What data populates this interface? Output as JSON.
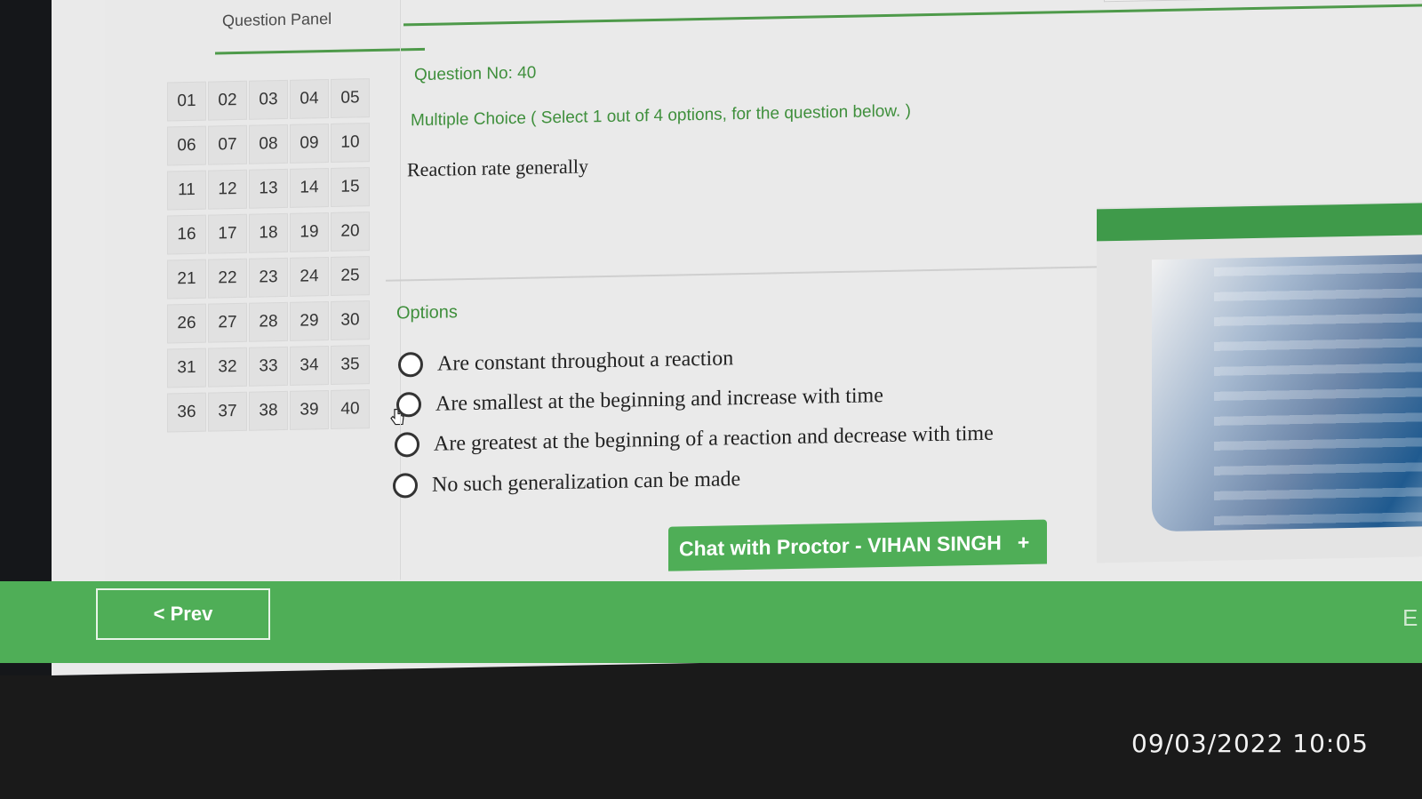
{
  "panel": {
    "title": "Question Panel",
    "questions": [
      "01",
      "02",
      "03",
      "04",
      "05",
      "06",
      "07",
      "08",
      "09",
      "10",
      "11",
      "12",
      "13",
      "14",
      "15",
      "16",
      "17",
      "18",
      "19",
      "20",
      "21",
      "22",
      "23",
      "24",
      "25",
      "26",
      "27",
      "28",
      "29",
      "30",
      "31",
      "32",
      "33",
      "34",
      "35",
      "36",
      "37",
      "38",
      "39",
      "40"
    ]
  },
  "question": {
    "number_label": "Question No: 40",
    "type_label": "Multiple Choice ( Select 1 out of 4 options, for the question below. )",
    "text": "Reaction rate generally"
  },
  "options": {
    "label": "Options",
    "items": [
      {
        "text": "Are constant throughout a reaction"
      },
      {
        "text": "Are smallest at the beginning and increase with time"
      },
      {
        "text": "Are greatest at the beginning of a reaction and decrease with time"
      },
      {
        "text": "No such generalization can be made"
      }
    ]
  },
  "chat": {
    "label": "Chat with Proctor - VIHAN SINGH",
    "plus": "+"
  },
  "nav": {
    "prev_label": "< Prev",
    "next_partial": "E"
  },
  "photo": {
    "timestamp": "09/03/2022 10:05"
  },
  "colors": {
    "accent_green": "#4fae57",
    "text_green": "#3f8f3c"
  }
}
